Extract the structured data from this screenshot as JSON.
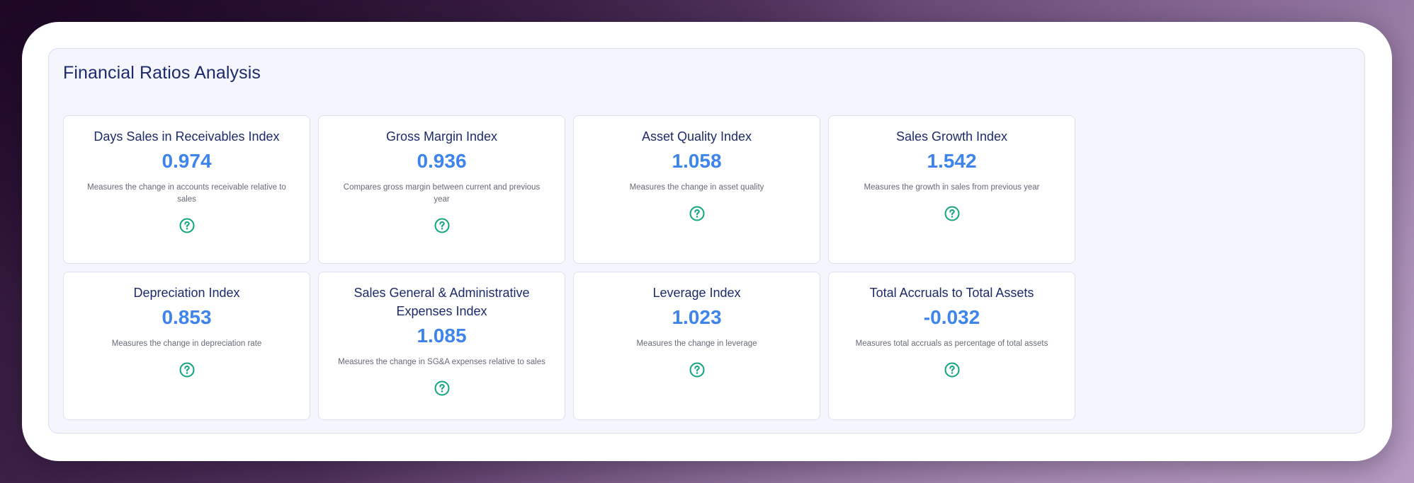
{
  "panel": {
    "title": "Financial Ratios Analysis"
  },
  "colors": {
    "accent_value": "#3d84ec",
    "title_text": "#1c2a6b",
    "help_icon": "#10a37f"
  },
  "cards": [
    {
      "title": "Days Sales in Receivables Index",
      "value": "0.974",
      "description": "Measures the change in accounts receivable relative to sales",
      "icon": "help-circle-icon"
    },
    {
      "title": "Gross Margin Index",
      "value": "0.936",
      "description": "Compares gross margin between current and previous year",
      "icon": "help-circle-icon"
    },
    {
      "title": "Asset Quality Index",
      "value": "1.058",
      "description": "Measures the change in asset quality",
      "icon": "help-circle-icon"
    },
    {
      "title": "Sales Growth Index",
      "value": "1.542",
      "description": "Measures the growth in sales from previous year",
      "icon": "help-circle-icon"
    },
    {
      "title": "Depreciation Index",
      "value": "0.853",
      "description": "Measures the change in depreciation rate",
      "icon": "help-circle-icon"
    },
    {
      "title": "Sales General & Administrative Expenses Index",
      "value": "1.085",
      "description": "Measures the change in SG&A expenses relative to sales",
      "icon": "help-circle-icon"
    },
    {
      "title": "Leverage Index",
      "value": "1.023",
      "description": "Measures the change in leverage",
      "icon": "help-circle-icon"
    },
    {
      "title": "Total Accruals to Total Assets",
      "value": "-0.032",
      "description": "Measures total accruals as percentage of total assets",
      "icon": "help-circle-icon"
    }
  ]
}
